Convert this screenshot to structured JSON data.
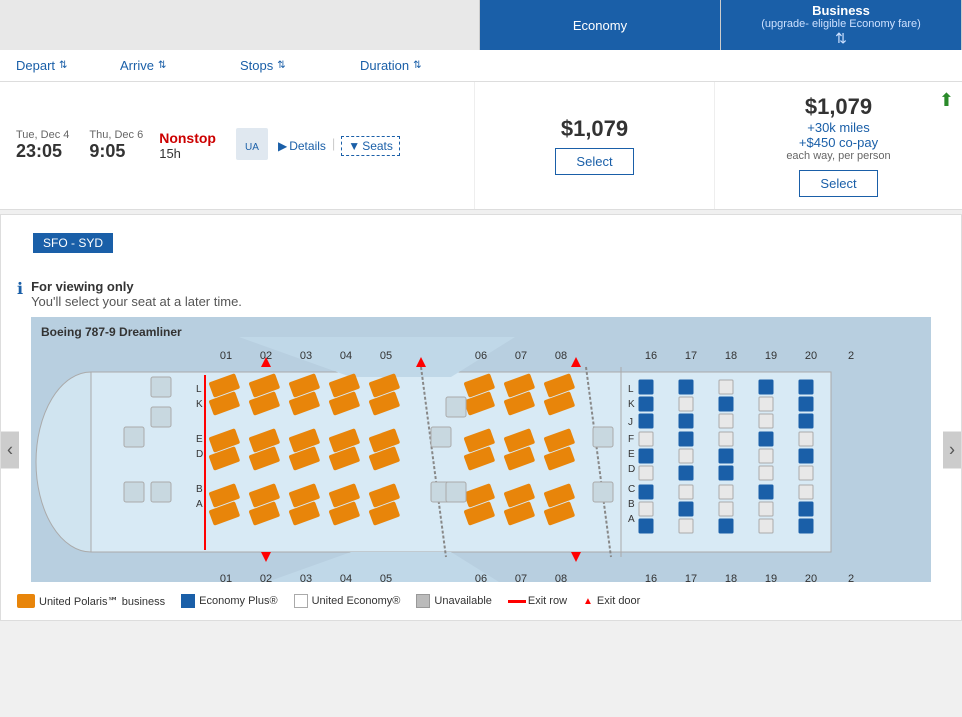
{
  "tabs": {
    "economy": {
      "label": "Economy",
      "active": true
    },
    "business": {
      "label": "Business",
      "sublabel": "(upgrade- eligible Economy fare)",
      "active": false
    }
  },
  "columns": {
    "depart": "Depart",
    "arrive": "Arrive",
    "stops": "Stops",
    "duration": "Duration"
  },
  "flight": {
    "depart_date": "Tue, Dec 4",
    "depart_time": "23:05",
    "arrive_date": "Thu, Dec 6",
    "arrive_time": "9:05",
    "stops": "Nonstop",
    "duration": "15h",
    "details_label": "Details",
    "seats_label": "Seats"
  },
  "economy_price": {
    "amount": "$1,079",
    "select_label": "Select"
  },
  "business_price": {
    "amount": "$1,079",
    "miles": "+30k miles",
    "copay": "+$450 co-pay",
    "per_person": "each way, per person",
    "select_label": "Select",
    "upgrade_icon": "⬆"
  },
  "seat_map": {
    "route": "SFO - SYD",
    "viewing_title": "For viewing only",
    "viewing_sub": "You'll select your seat at a later time.",
    "plane_name": "Boeing 787-9 Dreamliner",
    "nav_left": "‹",
    "nav_right": "›"
  },
  "legend": {
    "polaris_label": "United Polaris℠ business",
    "eplus_label": "Economy Plus®",
    "economy_label": "United Economy®",
    "unavail_label": "Unavailable",
    "exit_row_label": "Exit row",
    "exit_door_label": "Exit door"
  }
}
